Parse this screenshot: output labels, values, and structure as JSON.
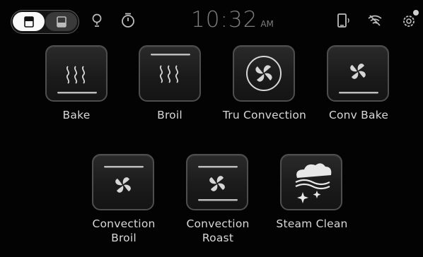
{
  "status_bar": {
    "oven_toggle": {
      "upper_selected": true
    },
    "icons": [
      "lightbulb-icon",
      "timer-icon",
      "remote-enable-icon",
      "wifi-off-icon",
      "settings-icon"
    ],
    "time": "10:32",
    "ampm": "AM"
  },
  "modes": [
    {
      "label": "Bake",
      "icon": "bake-icon"
    },
    {
      "label": "Broil",
      "icon": "broil-icon"
    },
    {
      "label": "Tru Convection",
      "icon": "tru-convection-icon"
    },
    {
      "label": "Conv Bake",
      "icon": "conv-bake-icon"
    },
    {
      "label_line1": "Convection",
      "label_line2": "Broil",
      "icon": "convection-broil-icon"
    },
    {
      "label_line1": "Convection",
      "label_line2": "Roast",
      "icon": "convection-roast-icon"
    },
    {
      "label": "Steam Clean",
      "icon": "steam-clean-icon"
    }
  ],
  "colors": {
    "background": "#000000",
    "tile_border": "#4e4e4e",
    "label": "#d8d8d8",
    "clock": "#7d7d7d"
  }
}
